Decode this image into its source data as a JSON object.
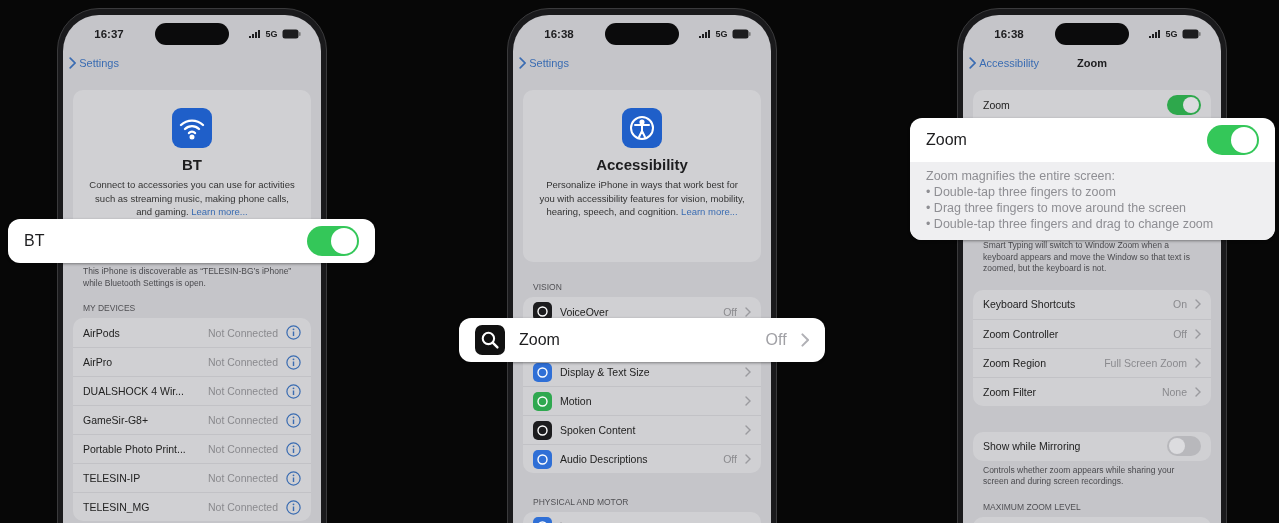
{
  "phones": [
    {
      "status": {
        "time": "16:37",
        "network": "5G"
      },
      "nav": {
        "back": "Settings"
      },
      "sections": [
        {
          "kind": "hero",
          "title": "BT",
          "text": "Connect to accessories you can use for activities such as streaming music, making phone calls, and gaming.",
          "link": "Learn more..."
        },
        {
          "kind": "footer",
          "text": "This iPhone is discoverable as “TELESIN-BG’s iPhone” while Bluetooth Settings is open."
        },
        {
          "kind": "header",
          "text": "MY DEVICES"
        },
        {
          "kind": "list",
          "rows": [
            {
              "kind": "info",
              "label": "AirPods",
              "value": "Not Connected"
            },
            {
              "kind": "info",
              "label": "AirPro",
              "value": "Not Connected"
            },
            {
              "kind": "info",
              "label": "DUALSHOCK 4 Wir...",
              "value": "Not Connected"
            },
            {
              "kind": "info",
              "label": "GameSir-G8+",
              "value": "Not Connected"
            },
            {
              "kind": "info",
              "label": "Portable Photo Print...",
              "value": "Not Connected"
            },
            {
              "kind": "info",
              "label": "TELESIN-IP",
              "value": "Not Connected"
            },
            {
              "kind": "info",
              "label": "TELESIN_MG",
              "value": "Not Connected"
            }
          ]
        }
      ]
    },
    {
      "status": {
        "time": "16:38",
        "network": "5G"
      },
      "nav": {
        "back": "Settings"
      },
      "sections": [
        {
          "kind": "hero",
          "title": "Accessibility",
          "text": "Personalize iPhone in ways that work best for you with accessibility features for vision, mobility, hearing, speech, and cognition.",
          "link": "Learn more..."
        },
        {
          "kind": "header",
          "text": "VISION"
        },
        {
          "kind": "list",
          "rows": [
            {
              "kind": "detail",
              "label": "VoiceOver",
              "value": "Off",
              "color": "#1c1c1e"
            },
            {
              "kind": "detail",
              "label": "Display & Text Size",
              "color": "#2f6fd6"
            },
            {
              "kind": "detail",
              "label": "Motion",
              "color": "#2fa84f"
            },
            {
              "kind": "detail",
              "label": "Spoken Content",
              "color": "#1c1c1e"
            },
            {
              "kind": "detail",
              "label": "Audio Descriptions",
              "value": "Off",
              "color": "#2f6fd6"
            }
          ]
        },
        {
          "kind": "header",
          "text": "PHYSICAL AND MOTOR"
        },
        {
          "kind": "list",
          "rows": [
            {
              "kind": "detail",
              "color": "#2f6fd6"
            }
          ]
        }
      ]
    },
    {
      "status": {
        "time": "16:38",
        "network": "5G"
      },
      "nav": {
        "back": "Accessibility",
        "title": "Zoom"
      },
      "sections": [
        {
          "kind": "list",
          "rows": [
            {
              "kind": "toggle",
              "label": "Zoom",
              "on": true
            }
          ]
        },
        {
          "kind": "footer",
          "text": "Smart Typing will switch to Window Zoom when a keyboard appears and move the Window so that text is zoomed, but the keyboard is not."
        },
        {
          "kind": "list",
          "rows": [
            {
              "kind": "detail",
              "label": "Keyboard Shortcuts",
              "value": "On"
            },
            {
              "kind": "detail",
              "label": "Zoom Controller",
              "value": "Off"
            },
            {
              "kind": "detail",
              "label": "Zoom Region",
              "value": "Full Screen Zoom"
            },
            {
              "kind": "detail",
              "label": "Zoom Filter",
              "value": "None"
            }
          ]
        },
        {
          "kind": "list",
          "rows": [
            {
              "kind": "toggle",
              "label": "Show while Mirroring",
              "on": false
            }
          ]
        },
        {
          "kind": "footer",
          "text": "Controls whether zoom appears while sharing your screen and during screen recordings."
        },
        {
          "kind": "header",
          "text": "MAXIMUM ZOOM LEVEL"
        },
        {
          "kind": "list"
        }
      ]
    }
  ],
  "callouts": [
    {
      "kind": "toggle",
      "label": "BT",
      "on": true
    },
    {
      "kind": "detail",
      "label": "Zoom",
      "value": "Off"
    },
    {
      "kind": "toggle",
      "label": "Zoom",
      "on": true,
      "note": "Zoom magnifies the entire screen:",
      "bullets": [
        "• Double-tap three fingers to zoom",
        "• Drag three fingers to move around the screen",
        "• Double-tap three fingers and drag to change zoom"
      ]
    }
  ]
}
